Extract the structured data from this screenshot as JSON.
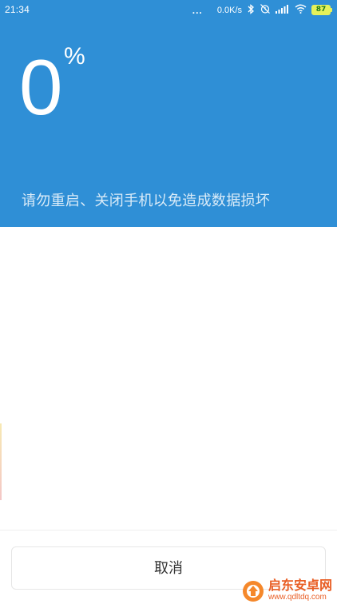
{
  "status_bar": {
    "time": "21:34",
    "dots": "...",
    "network_speed": "0.0K/s",
    "battery": "87",
    "icons": [
      "bluetooth-icon",
      "alarm-off-icon",
      "signal-icon",
      "wifi-icon",
      "battery-icon"
    ]
  },
  "progress": {
    "value": "0",
    "unit": "%"
  },
  "warning_text": "请勿重启、关闭手机以免造成数据损坏",
  "cancel_label": "取消",
  "watermark": {
    "title": "启东安卓网",
    "url": "www.qdltdq.com"
  },
  "colors": {
    "header_bg": "#2f8fd6",
    "text_white": "#ffffff",
    "button_border": "#e6e6e6"
  }
}
